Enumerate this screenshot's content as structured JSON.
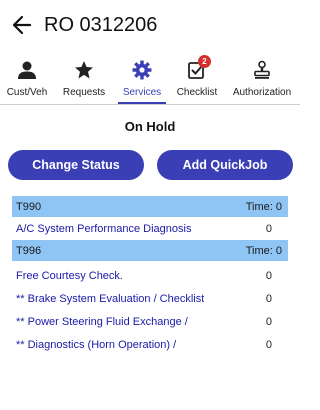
{
  "header": {
    "title": "RO 0312206"
  },
  "tabs": [
    {
      "label": "Cust/Veh",
      "icon": "person-icon"
    },
    {
      "label": "Requests",
      "icon": "star-icon"
    },
    {
      "label": "Services",
      "icon": "gear-icon",
      "active": true
    },
    {
      "label": "Checklist",
      "icon": "checklist-icon",
      "badge": "2"
    },
    {
      "label": "Authorization",
      "icon": "stamp-icon"
    }
  ],
  "status": "On Hold",
  "buttons": {
    "change_status": "Change Status",
    "add_quickjob": "Add QuickJob"
  },
  "groups": [
    {
      "code": "T990",
      "time": "Time: 0",
      "items": [
        {
          "desc": "A/C System Performance Diagnosis",
          "qty": "0"
        }
      ]
    },
    {
      "code": "T996",
      "time": "Time: 0",
      "items": [
        {
          "desc": "Free Courtesy Check.",
          "qty": "0"
        },
        {
          "desc": "** Brake System Evaluation / Checklist",
          "qty": "0"
        },
        {
          "desc": "** Power Steering Fluid Exchange /",
          "qty": "0"
        },
        {
          "desc": "** Diagnostics (Horn Operation) /",
          "qty": "0"
        }
      ]
    }
  ],
  "colors": {
    "accent": "#3a3fb5",
    "group_header_bg": "#8ec5f5",
    "badge": "#d32f2f",
    "link_text": "#1a1aa8"
  }
}
